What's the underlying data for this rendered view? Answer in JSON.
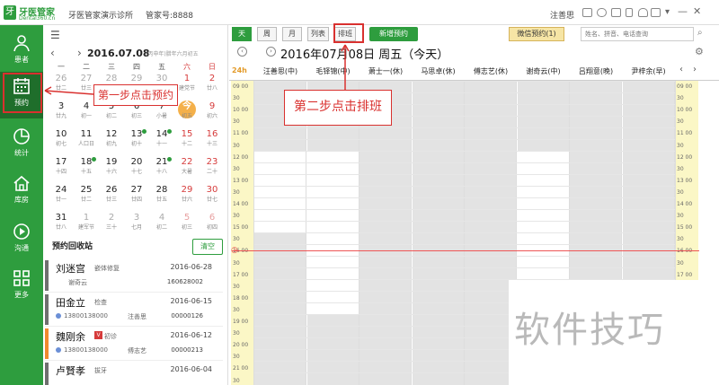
{
  "titlebar": {
    "logo_mark": "牙",
    "logo_text": "牙医管家",
    "logo_sub": "Dental360.cn",
    "clinic": "牙医管家演示诊所",
    "manager_no": "管家号:8888",
    "username": "注善思"
  },
  "leftnav": {
    "items": [
      {
        "label": "患者",
        "icon": "person-icon"
      },
      {
        "label": "预约",
        "icon": "calendar-icon"
      },
      {
        "label": "统计",
        "icon": "pie-chart-icon"
      },
      {
        "label": "库房",
        "icon": "house-icon"
      },
      {
        "label": "沟通",
        "icon": "play-circle-icon"
      },
      {
        "label": "更多",
        "icon": "grid-icon"
      }
    ]
  },
  "calendar": {
    "current_date": "2016.07.08",
    "lunar": "(丙申年)腊年六月初五",
    "weekdays": [
      "一",
      "二",
      "三",
      "四",
      "五",
      "六",
      "日"
    ],
    "rows": [
      [
        {
          "d": "26",
          "l": "廿二",
          "dim": true
        },
        {
          "d": "27",
          "l": "廿三",
          "dim": true
        },
        {
          "d": "28",
          "l": "廿四",
          "dim": true
        },
        {
          "d": "29",
          "l": "廿五",
          "dim": true
        },
        {
          "d": "30",
          "l": "廿六",
          "dim": true
        },
        {
          "d": "1",
          "l": "建党节"
        },
        {
          "d": "2",
          "l": "廿八"
        }
      ],
      [
        {
          "d": "3",
          "l": "廿九"
        },
        {
          "d": "4",
          "l": "初一"
        },
        {
          "d": "5",
          "l": "初二"
        },
        {
          "d": "6",
          "l": "初三"
        },
        {
          "d": "7",
          "l": "小暑"
        },
        {
          "d": "今",
          "l": "初五",
          "today": true
        },
        {
          "d": "9",
          "l": "初六"
        }
      ],
      [
        {
          "d": "10",
          "l": "初七"
        },
        {
          "d": "11",
          "l": "人口日"
        },
        {
          "d": "12",
          "l": "初九"
        },
        {
          "d": "13",
          "l": "初十",
          "dot": true
        },
        {
          "d": "14",
          "l": "十一",
          "dot": true
        },
        {
          "d": "15",
          "l": "十二"
        },
        {
          "d": "16",
          "l": "十三"
        }
      ],
      [
        {
          "d": "17",
          "l": "十四"
        },
        {
          "d": "18",
          "l": "十五",
          "dot": true
        },
        {
          "d": "19",
          "l": "十六"
        },
        {
          "d": "20",
          "l": "十七"
        },
        {
          "d": "21",
          "l": "十八",
          "dot": true
        },
        {
          "d": "22",
          "l": "大暑"
        },
        {
          "d": "23",
          "l": "二十"
        }
      ],
      [
        {
          "d": "24",
          "l": "廿一"
        },
        {
          "d": "25",
          "l": "廿二"
        },
        {
          "d": "26",
          "l": "廿三"
        },
        {
          "d": "27",
          "l": "廿四"
        },
        {
          "d": "28",
          "l": "廿五"
        },
        {
          "d": "29",
          "l": "廿六"
        },
        {
          "d": "30",
          "l": "廿七"
        }
      ],
      [
        {
          "d": "31",
          "l": "廿八"
        },
        {
          "d": "1",
          "l": "建军节",
          "dim": true
        },
        {
          "d": "2",
          "l": "三十",
          "dim": true
        },
        {
          "d": "3",
          "l": "七月",
          "dim": true
        },
        {
          "d": "4",
          "l": "初二",
          "dim": true
        },
        {
          "d": "5",
          "l": "初三",
          "dim": true
        },
        {
          "d": "6",
          "l": "初四",
          "dim": true
        }
      ]
    ]
  },
  "recycle": {
    "title": "预约回收站",
    "clear_label": "清空",
    "cards": [
      {
        "name": "刘迷宫",
        "tag": "嵌体修复",
        "date": "2016-06-28",
        "phone": "",
        "doctor": "谢奇云",
        "no": "160628002",
        "color": "#6f6f6f",
        "badge": ""
      },
      {
        "name": "田金立",
        "tag": "检查",
        "date": "2016-06-15",
        "phone": "13800138000",
        "doctor": "注善思",
        "no": "00000126",
        "color": "#6f6f6f",
        "badge": ""
      },
      {
        "name": "魏刚余",
        "tag": "初诊",
        "date": "2016-06-12",
        "phone": "13800138000",
        "doctor": "傅志艺",
        "no": "00000213",
        "color": "#f08a2e",
        "badge": "V"
      },
      {
        "name": "卢賢孝",
        "tag": "拔牙",
        "date": "2016-06-04",
        "phone": "",
        "doctor": "",
        "no": "",
        "color": "#6f6f6f",
        "badge": ""
      }
    ]
  },
  "schedule": {
    "view_buttons": [
      "天",
      "周",
      "月",
      "列表",
      "排班"
    ],
    "new_appt_label": "新增预约",
    "wechat_label": "微信预约(1)",
    "search_placeholder": "姓名、拼音、电话查询",
    "title": "2016年07月08日 周五（今天）",
    "h24_label": "24h",
    "doctors": [
      "汪善思(中)",
      "毛铎锦(中)",
      "萧士一(休)",
      "马思卓(休)",
      "傅志艺(休)",
      "谢奇云(中)",
      "吕翔意(晚)",
      "尹梓余(早)"
    ],
    "time_labels": [
      "09 00",
      "30",
      "10 00",
      "30",
      "11 00",
      "30",
      "12 00",
      "30",
      "13 00",
      "30",
      "14 00",
      "30",
      "15 00",
      "30",
      "16 00",
      "30",
      "17 00",
      "30",
      "18 00",
      "30",
      "19 00",
      "30",
      "20 00",
      "30",
      "21 00",
      "30"
    ]
  },
  "annotations": {
    "step1": "第一步点击预约",
    "step2": "第二步点击排班",
    "arrow_color": "#d9312f"
  },
  "watermark": "软件技巧"
}
